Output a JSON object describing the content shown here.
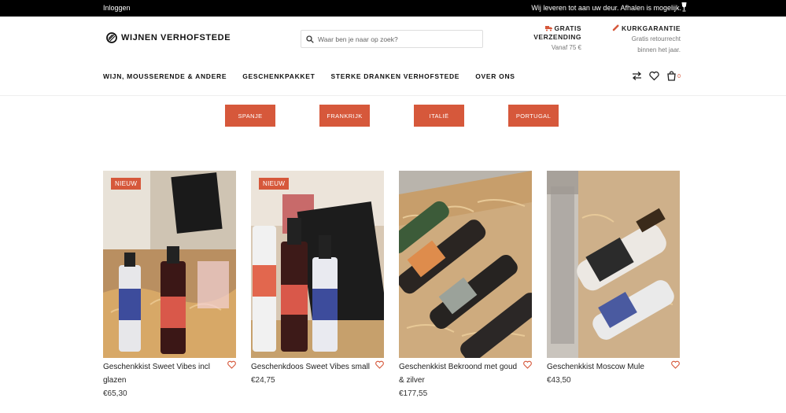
{
  "topbar": {
    "login": "Inloggen",
    "shipping_msg": "Wij leveren tot aan uw deur. Afhalen is mogelijk."
  },
  "brand": {
    "name": "WIJNEN VERHOFSTEDE"
  },
  "search": {
    "placeholder": "Waar ben je naar op zoek?"
  },
  "usps": [
    {
      "title_line1": "GRATIS",
      "title_line2": "VERZENDING",
      "sub_line1": "Vanaf 75 €",
      "sub_line2": ""
    },
    {
      "title_line1": "KURKGARANTIE",
      "title_line2": "",
      "sub_line1": "Gratis retourrecht",
      "sub_line2": "binnen het jaar."
    }
  ],
  "nav": [
    "WIJN, MOUSSERENDE & ANDERE",
    "GESCHENKPAKKET",
    "STERKE DRANKEN VERHOFSTEDE",
    "OVER ONS"
  ],
  "header_icons": {
    "cart_count": "0",
    "compare": "compare-arrows-icon",
    "wishlist": "heart-icon",
    "cart": "shopping-bag-icon"
  },
  "countries": [
    "SPANJE",
    "FRANKRIJK",
    "ITALIË",
    "PORTUGAL"
  ],
  "products": [
    {
      "name": "Geschenkkist Sweet Vibes incl glazen",
      "price": "€65,30",
      "badge": "NIEUW"
    },
    {
      "name": "Geschenkdoos Sweet Vibes small",
      "price": "€24,75",
      "badge": "NIEUW"
    },
    {
      "name": "Geschenkkist Bekroond met goud & zilver",
      "price": "€177,55",
      "badge": ""
    },
    {
      "name": "Geschenkkist Moscow Mule",
      "price": "€43,50",
      "badge": ""
    }
  ],
  "colors": {
    "accent": "#d6583b",
    "topbar": "#000000"
  }
}
